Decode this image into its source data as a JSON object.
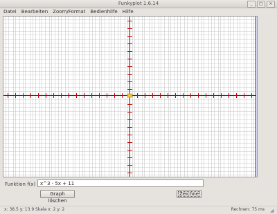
{
  "window": {
    "title": "Funkyplot 1.6.14",
    "controls": {
      "minimize": "_",
      "maximize": "□",
      "close": "×"
    }
  },
  "menu": {
    "items": [
      "Datei",
      "Bearbeiten",
      "Zoom/Format",
      "Bedienhilfe",
      "Hilfe"
    ]
  },
  "plot": {
    "background": "#ffffff",
    "grid_color": "#c8c8c8",
    "axis_color": "#1a1a1a",
    "tick_color": "#cc0000",
    "right_border_color": "#2222aa",
    "origin_marker_color": "#f0c040"
  },
  "function_bar": {
    "label": "Funktion f(x) =",
    "value": "x^3 - 5x + 11",
    "clear_button": "Graph löschen",
    "plot_button": "Zeichne"
  },
  "status": {
    "left": "x: 38.5  y: 13.9   Skala x: 2  y: 2",
    "right": "Rechnen: 75 ms"
  }
}
